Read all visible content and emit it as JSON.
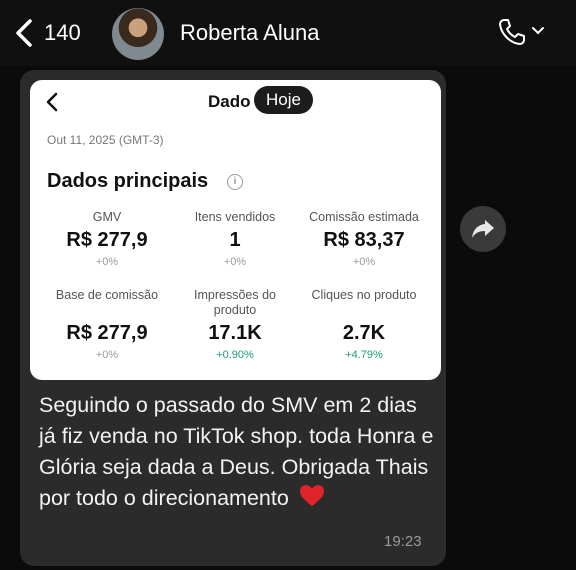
{
  "header": {
    "unread_count": "140",
    "contact_name": "Roberta Aluna"
  },
  "screenshot": {
    "title": "Dado",
    "today_pill": "Hoje",
    "date": "Out 11, 2025 (GMT-3)",
    "section_title": "Dados principais",
    "metrics": [
      {
        "label": "GMV",
        "value": "R$ 277,9",
        "delta": "+0%"
      },
      {
        "label": "Itens vendidos",
        "value": "1",
        "delta": "+0%"
      },
      {
        "label": "Comissão estimada",
        "value": "R$ 83,37",
        "delta": "+0%"
      },
      {
        "label": "Base de comissão",
        "value": "R$ 277,9",
        "delta": "+0%"
      },
      {
        "label": "Impressões do produto",
        "value": "17.1K",
        "delta": "+0.90%"
      },
      {
        "label": "Cliques no produto",
        "value": "2.7K",
        "delta": "+4.79%"
      }
    ]
  },
  "message": {
    "text": "Seguindo o passado do SMV em 2 dias já fiz venda no TikTok shop. toda Honra e Glória seja dada a Deus. Obrigada Thais por todo o direcionamento",
    "time": "19:23"
  },
  "colors": {
    "background": "#0b0b0b",
    "bubble": "#2b2b2b",
    "positive_delta": "#1a9f6a"
  }
}
